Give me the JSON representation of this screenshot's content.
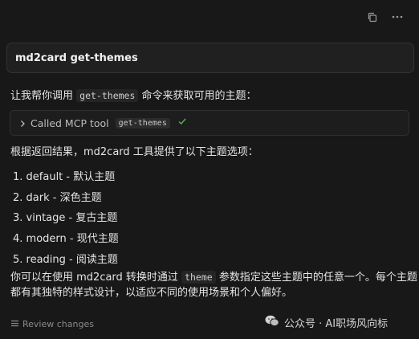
{
  "toolbar": {
    "copy_icon": "copy-icon",
    "more_icon": "more-icon"
  },
  "prompt": {
    "text": "md2card get-themes"
  },
  "intro": {
    "prefix": "让我帮你调用",
    "code": "get-themes",
    "suffix": "命令来获取可用的主题："
  },
  "tool_call": {
    "label": "Called MCP tool",
    "tool_name": "get-themes",
    "status_icon": "check-icon"
  },
  "result_heading": "根据返回结果，md2card 工具提供了以下主题选项：",
  "themes": [
    "1. default - 默认主题",
    "2. dark - 深色主题",
    "3. vintage - 复古主题",
    "4. modern - 现代主题",
    "5. reading - 阅读主题"
  ],
  "closing": {
    "line1_prefix": "你可以在使用 md2card 转换时通过",
    "code": "theme",
    "line1_suffix": "参数指定这些主题中的任意一个。每个主题",
    "line2": "都有其独特的样式设计，以适应不同的使用场景和个人偏好。"
  },
  "footer": {
    "review_label": "Review changes"
  },
  "watermark": {
    "text": "公众号 · AI职场风向标"
  },
  "colors": {
    "background": "#181818",
    "check": "#59b35b"
  }
}
